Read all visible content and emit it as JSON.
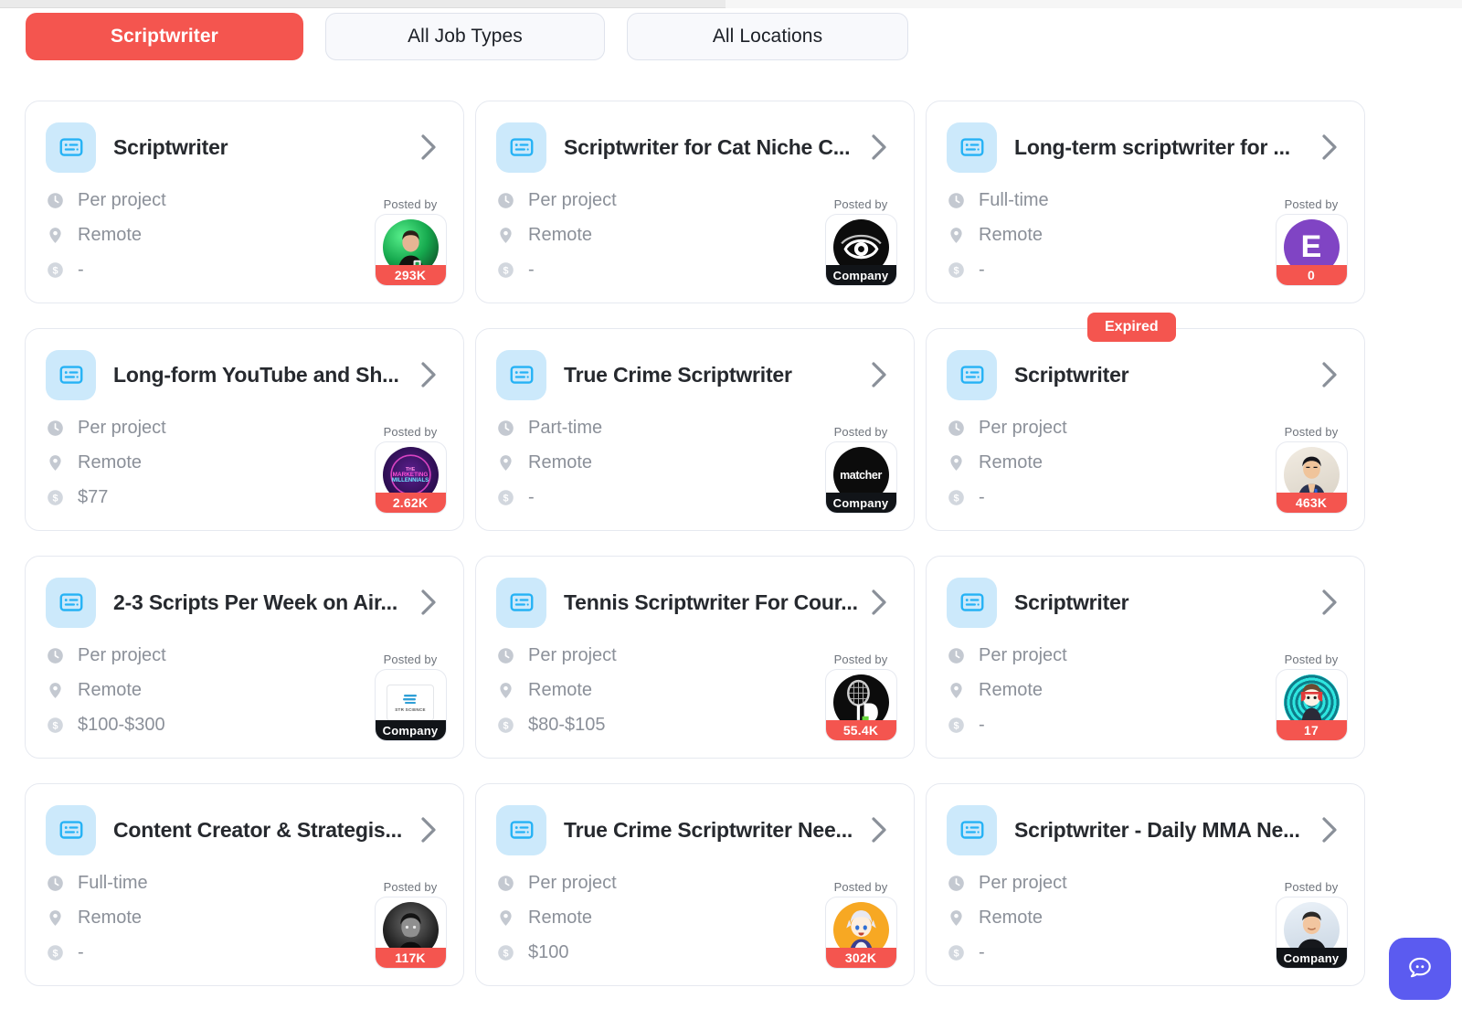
{
  "filters": [
    {
      "label": "Scriptwriter",
      "active": true,
      "name": "filter-scriptwriter"
    },
    {
      "label": "All Job Types",
      "active": false,
      "name": "filter-job-types"
    },
    {
      "label": "All Locations",
      "active": false,
      "name": "filter-locations"
    }
  ],
  "colors": {
    "accent_red": "#f4554f",
    "icon_blue": "#25b2f5",
    "icon_blue_bg": "#cce9fb",
    "fab_purple": "#5b5bf0",
    "meta_gray": "#8b9099"
  },
  "labels": {
    "posted_by": "Posted by",
    "company": "Company",
    "expired": "Expired"
  },
  "icons": {
    "job": "script-card-icon",
    "chevron": "chevron-right-icon",
    "clock": "clock-icon",
    "pin": "location-pin-icon",
    "money": "dollar-circle-icon",
    "fab": "chat-face-icon"
  },
  "cards": [
    {
      "title": "Scriptwriter",
      "job_type": "Per project",
      "location": "Remote",
      "pay": "-",
      "expired": false,
      "poster": {
        "kind": "count",
        "foot": "293K",
        "avatar": "green-gradient-man-photo",
        "bg": "#2fc66a",
        "fg": "#0d2b16"
      }
    },
    {
      "title": "Scriptwriter for Cat Niche C...",
      "job_type": "Per project",
      "location": "Remote",
      "pay": "-",
      "expired": false,
      "poster": {
        "kind": "company",
        "foot": "Company",
        "avatar": "black-eye-spiral-logo",
        "bg": "#0c0c0c",
        "fg": "#ffffff"
      }
    },
    {
      "title": "Long-term scriptwriter for ...",
      "job_type": "Full-time",
      "location": "Remote",
      "pay": "-",
      "expired": false,
      "poster": {
        "kind": "count",
        "foot": "0",
        "avatar": "purple-letter-avatar",
        "bg": "#8044c4",
        "fg": "#ffffff",
        "letter": "E"
      }
    },
    {
      "title": "Long-form YouTube and Sh...",
      "job_type": "Per project",
      "location": "Remote",
      "pay": "$77",
      "expired": false,
      "poster": {
        "kind": "count",
        "foot": "2.62K",
        "avatar": "marketing-millennials-logo",
        "bg": "#2a0d4e",
        "fg": "#ff4fd8"
      }
    },
    {
      "title": "True Crime Scriptwriter",
      "job_type": "Part-time",
      "location": "Remote",
      "pay": "-",
      "expired": false,
      "poster": {
        "kind": "company",
        "foot": "Company",
        "avatar": "matcher-wordmark-logo",
        "bg": "#0c0c0c",
        "fg": "#ffffff",
        "wordmark": "matcher"
      }
    },
    {
      "title": "Scriptwriter",
      "job_type": "Per project",
      "location": "Remote",
      "pay": "-",
      "expired": true,
      "poster": {
        "kind": "count",
        "foot": "463K",
        "avatar": "man-portrait-photo",
        "bg": "#e9e2d8",
        "fg": "#2b2b35"
      }
    },
    {
      "title": "2-3 Scripts Per Week on Air...",
      "job_type": "Per project",
      "location": "Remote",
      "pay": "$100-$300",
      "expired": false,
      "poster": {
        "kind": "company",
        "foot": "Company",
        "avatar": "str-science-logo",
        "bg": "#ffffff",
        "fg": "#2f9fd6",
        "wordmark": "STR SCIENCE"
      }
    },
    {
      "title": "Tennis Scriptwriter For Cour...",
      "job_type": "Per project",
      "location": "Remote",
      "pay": "$80-$105",
      "expired": false,
      "poster": {
        "kind": "count",
        "foot": "55.4K",
        "avatar": "tennis-racket-logo",
        "bg": "#0c0c0c",
        "fg": "#ffffff"
      }
    },
    {
      "title": "Scriptwriter",
      "job_type": "Per project",
      "location": "Remote",
      "pay": "-",
      "expired": false,
      "poster": {
        "kind": "count",
        "foot": "17",
        "avatar": "cyan-anime-character-logo",
        "bg": "#2ee6e0",
        "fg": "#1a1a2e"
      }
    },
    {
      "title": "Content Creator & Strategis...",
      "job_type": "Full-time",
      "location": "Remote",
      "pay": "-",
      "expired": false,
      "poster": {
        "kind": "count",
        "foot": "117K",
        "avatar": "bw-man-portrait-photo",
        "bg": "#1d1d1d",
        "fg": "#c9c9c9"
      }
    },
    {
      "title": "True Crime Scriptwriter Nee...",
      "job_type": "Per project",
      "location": "Remote",
      "pay": "$100",
      "expired": false,
      "poster": {
        "kind": "count",
        "foot": "302K",
        "avatar": "orange-anime-avatar",
        "bg": "#f7a823",
        "fg": "#e8e8f2"
      }
    },
    {
      "title": "Scriptwriter - Daily MMA Ne...",
      "job_type": "Per project",
      "location": "Remote",
      "pay": "-",
      "expired": false,
      "poster": {
        "kind": "company",
        "foot": "Company",
        "avatar": "smiling-man-photo",
        "bg": "#dfe6ee",
        "fg": "#20242b"
      }
    }
  ]
}
